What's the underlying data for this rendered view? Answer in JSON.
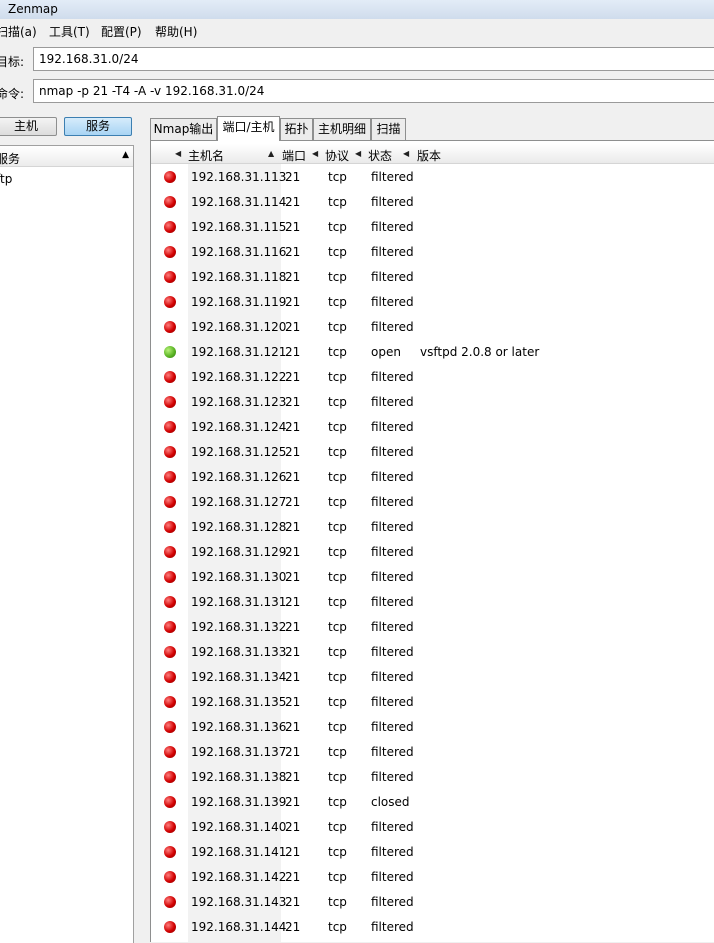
{
  "window": {
    "title": "Zenmap"
  },
  "menu": [
    {
      "label": "扫描(a)"
    },
    {
      "label": "工具(T)"
    },
    {
      "label": "配置(P)"
    },
    {
      "label": "帮助(H)"
    }
  ],
  "target": {
    "label": "目标:",
    "value": "192.168.31.0/24"
  },
  "command": {
    "label": "命令:",
    "value": "nmap -p 21 -T4 -A -v 192.168.31.0/24"
  },
  "view_buttons": {
    "hosts": "主机",
    "services": "服务"
  },
  "left_panel": {
    "header": "服务",
    "items": [
      "ftp"
    ]
  },
  "tabs": [
    {
      "label": "Nmap输出"
    },
    {
      "label": "端口/主机"
    },
    {
      "label": "拓扑"
    },
    {
      "label": "主机明细"
    },
    {
      "label": "扫描"
    }
  ],
  "table": {
    "columns": [
      "主机名",
      "端口",
      "协议",
      "状态",
      "版本"
    ],
    "rows": [
      {
        "host": "192.168.31.113",
        "port": "21",
        "proto": "tcp",
        "state": "filtered",
        "version": ""
      },
      {
        "host": "192.168.31.114",
        "port": "21",
        "proto": "tcp",
        "state": "filtered",
        "version": ""
      },
      {
        "host": "192.168.31.115",
        "port": "21",
        "proto": "tcp",
        "state": "filtered",
        "version": ""
      },
      {
        "host": "192.168.31.116",
        "port": "21",
        "proto": "tcp",
        "state": "filtered",
        "version": ""
      },
      {
        "host": "192.168.31.118",
        "port": "21",
        "proto": "tcp",
        "state": "filtered",
        "version": ""
      },
      {
        "host": "192.168.31.119",
        "port": "21",
        "proto": "tcp",
        "state": "filtered",
        "version": ""
      },
      {
        "host": "192.168.31.120",
        "port": "21",
        "proto": "tcp",
        "state": "filtered",
        "version": ""
      },
      {
        "host": "192.168.31.121",
        "port": "21",
        "proto": "tcp",
        "state": "open",
        "version": "vsftpd 2.0.8 or later"
      },
      {
        "host": "192.168.31.122",
        "port": "21",
        "proto": "tcp",
        "state": "filtered",
        "version": ""
      },
      {
        "host": "192.168.31.123",
        "port": "21",
        "proto": "tcp",
        "state": "filtered",
        "version": ""
      },
      {
        "host": "192.168.31.124",
        "port": "21",
        "proto": "tcp",
        "state": "filtered",
        "version": ""
      },
      {
        "host": "192.168.31.125",
        "port": "21",
        "proto": "tcp",
        "state": "filtered",
        "version": ""
      },
      {
        "host": "192.168.31.126",
        "port": "21",
        "proto": "tcp",
        "state": "filtered",
        "version": ""
      },
      {
        "host": "192.168.31.127",
        "port": "21",
        "proto": "tcp",
        "state": "filtered",
        "version": ""
      },
      {
        "host": "192.168.31.128",
        "port": "21",
        "proto": "tcp",
        "state": "filtered",
        "version": ""
      },
      {
        "host": "192.168.31.129",
        "port": "21",
        "proto": "tcp",
        "state": "filtered",
        "version": ""
      },
      {
        "host": "192.168.31.130",
        "port": "21",
        "proto": "tcp",
        "state": "filtered",
        "version": ""
      },
      {
        "host": "192.168.31.131",
        "port": "21",
        "proto": "tcp",
        "state": "filtered",
        "version": ""
      },
      {
        "host": "192.168.31.132",
        "port": "21",
        "proto": "tcp",
        "state": "filtered",
        "version": ""
      },
      {
        "host": "192.168.31.133",
        "port": "21",
        "proto": "tcp",
        "state": "filtered",
        "version": ""
      },
      {
        "host": "192.168.31.134",
        "port": "21",
        "proto": "tcp",
        "state": "filtered",
        "version": ""
      },
      {
        "host": "192.168.31.135",
        "port": "21",
        "proto": "tcp",
        "state": "filtered",
        "version": ""
      },
      {
        "host": "192.168.31.136",
        "port": "21",
        "proto": "tcp",
        "state": "filtered",
        "version": ""
      },
      {
        "host": "192.168.31.137",
        "port": "21",
        "proto": "tcp",
        "state": "filtered",
        "version": ""
      },
      {
        "host": "192.168.31.138",
        "port": "21",
        "proto": "tcp",
        "state": "filtered",
        "version": ""
      },
      {
        "host": "192.168.31.139",
        "port": "21",
        "proto": "tcp",
        "state": "closed",
        "version": ""
      },
      {
        "host": "192.168.31.140",
        "port": "21",
        "proto": "tcp",
        "state": "filtered",
        "version": ""
      },
      {
        "host": "192.168.31.141",
        "port": "21",
        "proto": "tcp",
        "state": "filtered",
        "version": ""
      },
      {
        "host": "192.168.31.142",
        "port": "21",
        "proto": "tcp",
        "state": "filtered",
        "version": ""
      },
      {
        "host": "192.168.31.143",
        "port": "21",
        "proto": "tcp",
        "state": "filtered",
        "version": ""
      },
      {
        "host": "192.168.31.144",
        "port": "21",
        "proto": "tcp",
        "state": "filtered",
        "version": ""
      }
    ]
  },
  "colors": {
    "open_dot": "#5cb525",
    "closed_dot": "#d10000",
    "active_button": "#a8d4f4"
  }
}
